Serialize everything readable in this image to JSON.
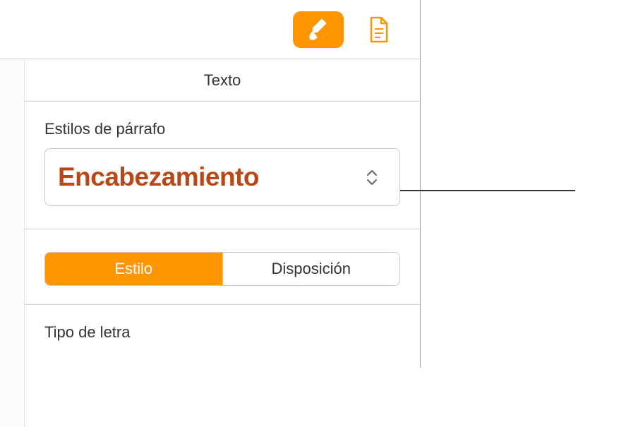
{
  "header": {
    "title": "Texto"
  },
  "paragraph_styles": {
    "label": "Estilos de párrafo",
    "selected_value": "Encabezamiento"
  },
  "segments": {
    "style": "Estilo",
    "layout": "Disposición"
  },
  "font": {
    "label": "Tipo de letra"
  },
  "colors": {
    "accent": "#ff9500",
    "heading_text": "#b94717"
  }
}
